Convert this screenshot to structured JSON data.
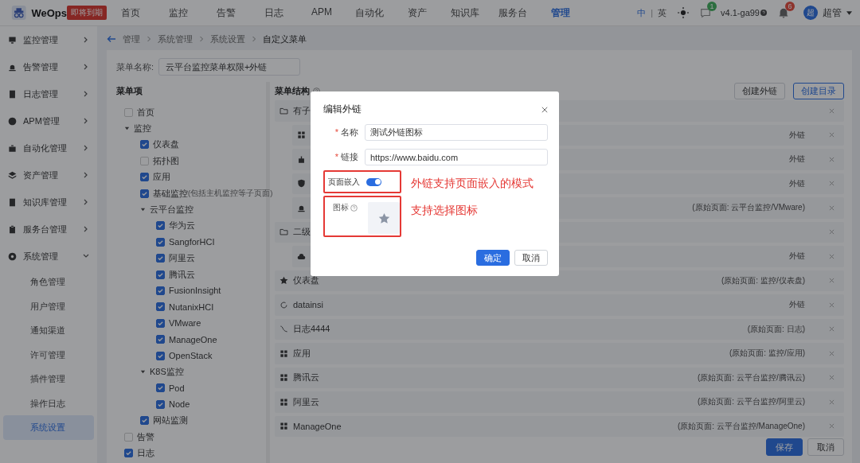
{
  "topbar": {
    "logo_text": "WeOps",
    "badge": "即将到期",
    "nav": [
      {
        "label": "首页",
        "selected": false
      },
      {
        "label": "监控",
        "selected": false
      },
      {
        "label": "告警",
        "selected": false
      },
      {
        "label": "日志",
        "selected": false
      },
      {
        "label": "APM",
        "selected": false
      },
      {
        "label": "自动化",
        "selected": false
      },
      {
        "label": "资产",
        "selected": false
      },
      {
        "label": "知识库",
        "selected": false
      },
      {
        "label": "服务台",
        "selected": false
      },
      {
        "label": "管理",
        "selected": true
      }
    ],
    "languages": [
      {
        "label": "中",
        "selected": true
      },
      {
        "label": "英",
        "selected": false
      }
    ],
    "separator": "|",
    "message_count": "1",
    "version": "v4.1-ga99",
    "bell_count": "6",
    "avatar": "超",
    "user": "超管"
  },
  "sidebar": [
    {
      "label": "监控管理",
      "kind": "monitor",
      "expanded": false
    },
    {
      "label": "告警管理",
      "kind": "alarm",
      "expanded": false
    },
    {
      "label": "日志管理",
      "kind": "log",
      "expanded": false
    },
    {
      "label": "APM管理",
      "kind": "apm",
      "expanded": false
    },
    {
      "label": "自动化管理",
      "kind": "automation",
      "expanded": false
    },
    {
      "label": "资产管理",
      "kind": "asset",
      "expanded": false
    },
    {
      "label": "知识库管理",
      "kind": "kb",
      "expanded": false
    },
    {
      "label": "服务台管理",
      "kind": "service",
      "expanded": false
    },
    {
      "label": "系统管理",
      "kind": "system",
      "expanded": true,
      "children": [
        {
          "label": "角色管理",
          "selected": false
        },
        {
          "label": "用户管理",
          "selected": false
        },
        {
          "label": "通知渠道",
          "selected": false
        },
        {
          "label": "许可管理",
          "selected": false
        },
        {
          "label": "插件管理",
          "selected": false
        },
        {
          "label": "操作日志",
          "selected": false
        },
        {
          "label": "系统设置",
          "selected": true
        }
      ]
    }
  ],
  "breadcrumb": [
    "管理",
    "系统管理",
    "系统设置",
    "自定义菜单"
  ],
  "menu_name": {
    "label": "菜单名称:",
    "value": "云平台监控菜单权限+外链"
  },
  "menu_items": {
    "title": "菜单项",
    "tree": [
      {
        "label": "首页",
        "checked": false
      },
      {
        "label": "监控",
        "expanded": true,
        "children": [
          {
            "label": "仪表盘",
            "checked": true
          },
          {
            "label": "拓扑图",
            "checked": false
          },
          {
            "label": "应用",
            "checked": true
          },
          {
            "label": "基础监控",
            "hint": "(包括主机监控等子页面)",
            "checked": true
          },
          {
            "label": "云平台监控",
            "expanded": true,
            "children": [
              {
                "label": "华为云",
                "checked": true
              },
              {
                "label": "SangforHCI",
                "checked": true
              },
              {
                "label": "阿里云",
                "checked": true
              },
              {
                "label": "腾讯云",
                "checked": true
              },
              {
                "label": "FusionInsight",
                "checked": true
              },
              {
                "label": "NutanixHCI",
                "checked": true
              },
              {
                "label": "VMware",
                "checked": true
              },
              {
                "label": "ManageOne",
                "checked": true
              },
              {
                "label": "OpenStack",
                "checked": true
              }
            ]
          },
          {
            "label": "K8S监控",
            "expanded": true,
            "children": [
              {
                "label": "Pod",
                "checked": true
              },
              {
                "label": "Node",
                "checked": true
              }
            ]
          },
          {
            "label": "网站监测",
            "checked": true
          }
        ]
      },
      {
        "label": "告警",
        "checked": false
      },
      {
        "label": "日志",
        "checked": true
      }
    ]
  },
  "structure": {
    "title": "菜单结构",
    "buttons": [
      {
        "label": "创建外链",
        "primary": false
      },
      {
        "label": "创建目录",
        "primary": true
      }
    ],
    "rows": [
      {
        "kind": "folder",
        "label": "有子",
        "children": [
          {
            "kind": "grid",
            "tag": "外链"
          },
          {
            "kind": "robot",
            "tag": "外链"
          },
          {
            "kind": "shield",
            "tag": "外链"
          },
          {
            "kind": "alarm",
            "tag": "(原始页面: 云平台监控/VMware)"
          }
        ]
      },
      {
        "kind": "folder",
        "label": "二级",
        "children": [
          {
            "kind": "cloud",
            "tag": "外链"
          }
        ]
      },
      {
        "kind": "star",
        "label": "仪表盘",
        "tag": "(原始页面: 监控/仪表盘)"
      },
      {
        "kind": "circle",
        "label": "datainsi",
        "tag": "外链"
      },
      {
        "kind": "line",
        "label": "日志4444",
        "tag": "(原始页面: 日志)"
      },
      {
        "kind": "grid",
        "label": "应用",
        "tag": "(原始页面: 监控/应用)"
      },
      {
        "kind": "grid",
        "label": "腾讯云",
        "tag": "(原始页面: 云平台监控/腾讯云)"
      },
      {
        "kind": "grid",
        "label": "阿里云",
        "tag": "(原始页面: 云平台监控/阿里云)"
      },
      {
        "kind": "grid",
        "label": "ManageOne",
        "tag": "(原始页面: 云平台监控/ManageOne)"
      }
    ]
  },
  "footer_buttons": [
    {
      "label": "保存",
      "primary": true
    },
    {
      "label": "取消",
      "primary": false
    }
  ],
  "dialog": {
    "title": "编辑外链",
    "fields": [
      {
        "label": "名称",
        "required_mark": "*",
        "value": "测试外链图标"
      },
      {
        "label": "链接",
        "required_mark": "*",
        "value": "https://www.baidu.com"
      }
    ],
    "embed": {
      "label": "页面嵌入",
      "on": true,
      "note": "外链支持页面嵌入的模式"
    },
    "icon_field": {
      "label": "图标",
      "note": "支持选择图标"
    },
    "buttons": [
      {
        "label": "确定",
        "primary": true
      },
      {
        "label": "取消",
        "primary": false
      }
    ]
  }
}
